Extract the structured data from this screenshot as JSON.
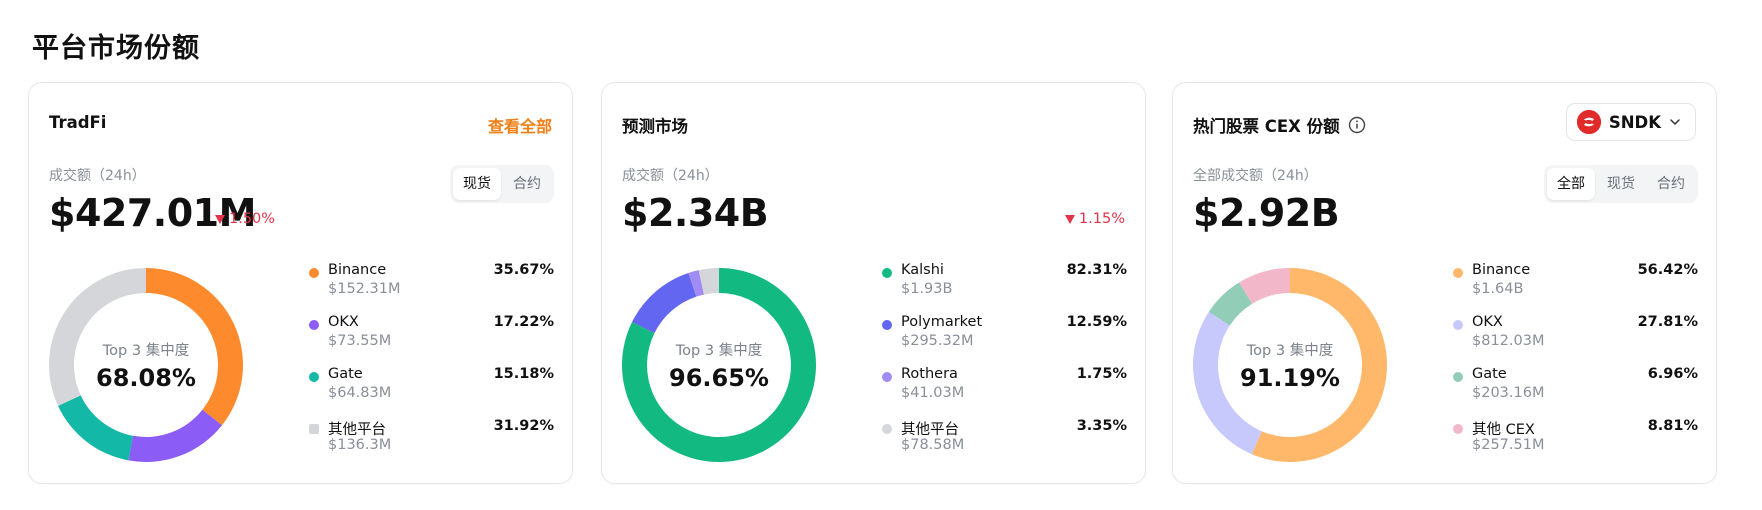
{
  "section_title": "平台市场份额",
  "cards": [
    {
      "title": "TradFi",
      "view_all": "查看全部",
      "volume_label": "成交额（24h）",
      "volume_value": "$427.01M",
      "change": "1.50%",
      "tabs": [
        "现货",
        "合约"
      ],
      "active_tab": "现货",
      "donut_caption": "Top 3 集中度",
      "donut_value": "68.08%",
      "legend": [
        {
          "name": "Binance",
          "amount": "$152.31M",
          "pct": "35.67%",
          "color": "#fd8a2c"
        },
        {
          "name": "OKX",
          "amount": "$73.55M",
          "pct": "17.22%",
          "color": "#8b5cf6"
        },
        {
          "name": "Gate",
          "amount": "$64.83M",
          "pct": "15.18%",
          "color": "#14b8a6"
        },
        {
          "name": "其他平台",
          "amount": "$136.3M",
          "pct": "31.92%",
          "color": "#d4d6da"
        }
      ]
    },
    {
      "title": "预测市场",
      "volume_label": "成交额（24h）",
      "volume_value": "$2.34B",
      "change": "1.15%",
      "donut_caption": "Top 3 集中度",
      "donut_value": "96.65%",
      "legend": [
        {
          "name": "Kalshi",
          "amount": "$1.93B",
          "pct": "82.31%",
          "color": "#12b981"
        },
        {
          "name": "Polymarket",
          "amount": "$295.32M",
          "pct": "12.59%",
          "color": "#6366f1"
        },
        {
          "name": "Rothera",
          "amount": "$41.03M",
          "pct": "1.75%",
          "color": "#a18cf5"
        },
        {
          "name": "其他平台",
          "amount": "$78.58M",
          "pct": "3.35%",
          "color": "#d4d6da"
        }
      ]
    },
    {
      "title": "热门股票 CEX 份额",
      "ticker": "SNDK",
      "volume_label": "全部成交额（24h）",
      "volume_value": "$2.92B",
      "tabs": [
        "全部",
        "现货",
        "合约"
      ],
      "active_tab": "全部",
      "donut_caption": "Top 3 集中度",
      "donut_value": "91.19%",
      "legend": [
        {
          "name": "Binance",
          "amount": "$1.64B",
          "pct": "56.42%",
          "color": "#ffb86a"
        },
        {
          "name": "OKX",
          "amount": "$812.03M",
          "pct": "27.81%",
          "color": "#c7c8fb"
        },
        {
          "name": "Gate",
          "amount": "$203.16M",
          "pct": "6.96%",
          "color": "#92cdb8"
        },
        {
          "name": "其他 CEX",
          "amount": "$257.51M",
          "pct": "8.81%",
          "color": "#f2b7c9"
        }
      ]
    }
  ],
  "icons": {
    "info": "info-icon",
    "chevron": "chevron-down-icon",
    "down_arrow": "triangle-down-icon"
  }
}
